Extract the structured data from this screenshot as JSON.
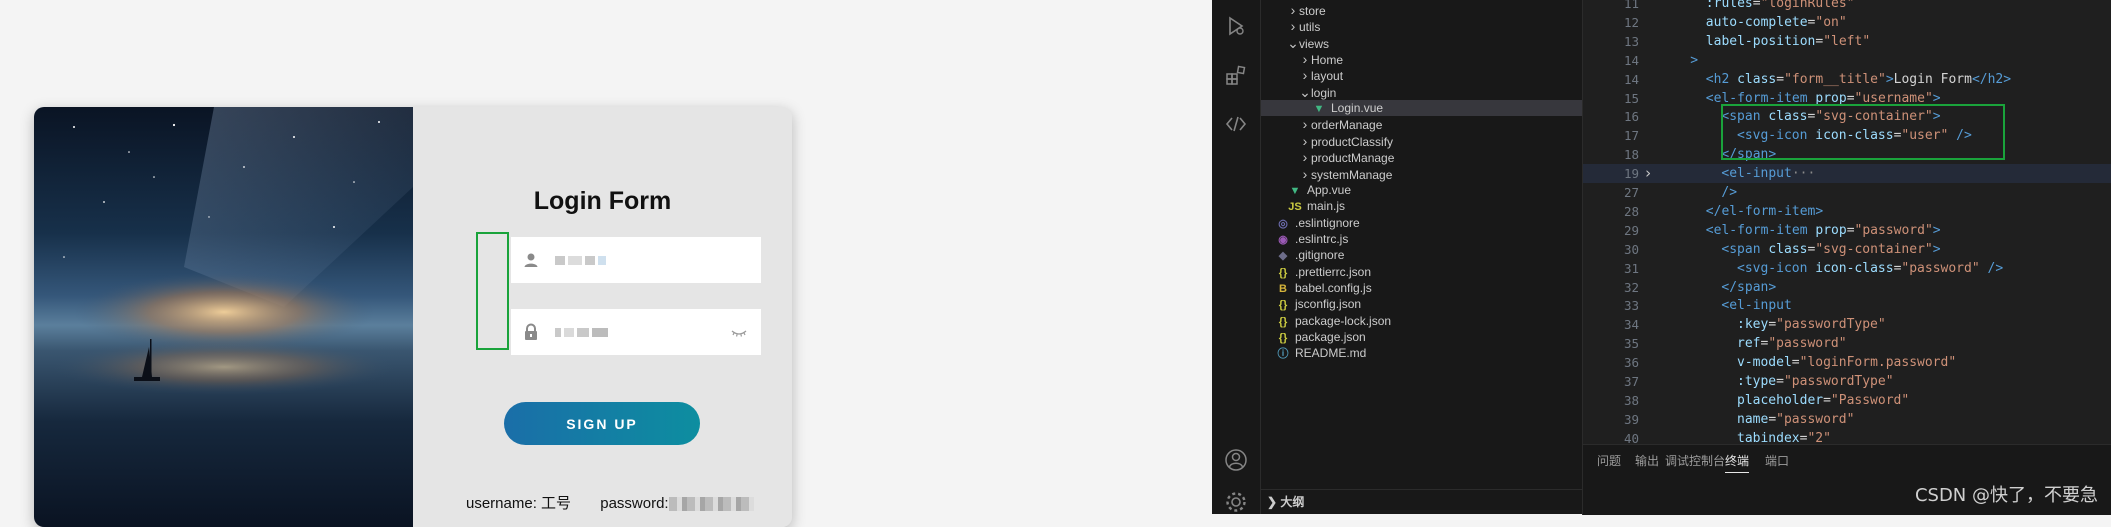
{
  "login": {
    "title": "Login Form",
    "username_placeholder": "",
    "signup_label": "SIGN UP",
    "creds_username": "username: 工号",
    "creds_password": "password:"
  },
  "explorer": {
    "items": [
      {
        "label": "store",
        "type": "folder",
        "open": false,
        "indent": 1
      },
      {
        "label": "utils",
        "type": "folder",
        "open": false,
        "indent": 1
      },
      {
        "label": "views",
        "type": "folder",
        "open": true,
        "indent": 1
      },
      {
        "label": "Home",
        "type": "folder",
        "open": false,
        "indent": 2
      },
      {
        "label": "layout",
        "type": "folder",
        "open": false,
        "indent": 2
      },
      {
        "label": "login",
        "type": "folder",
        "open": true,
        "indent": 2
      },
      {
        "label": "Login.vue",
        "type": "vue",
        "indent": 3,
        "active": true
      },
      {
        "label": "orderManage",
        "type": "folder",
        "open": false,
        "indent": 2
      },
      {
        "label": "productClassify",
        "type": "folder",
        "open": false,
        "indent": 2
      },
      {
        "label": "productManage",
        "type": "folder",
        "open": false,
        "indent": 2
      },
      {
        "label": "systemManage",
        "type": "folder",
        "open": false,
        "indent": 2
      },
      {
        "label": "App.vue",
        "type": "vue",
        "indent": 1
      },
      {
        "label": "main.js",
        "type": "js",
        "indent": 1
      },
      {
        "label": ".eslintignore",
        "type": "eslintignore",
        "indent": 0
      },
      {
        "label": ".eslintrc.js",
        "type": "eslintrc",
        "indent": 0
      },
      {
        "label": ".gitignore",
        "type": "git",
        "indent": 0
      },
      {
        "label": ".prettierrc.json",
        "type": "json",
        "indent": 0
      },
      {
        "label": "babel.config.js",
        "type": "babel",
        "indent": 0
      },
      {
        "label": "jsconfig.json",
        "type": "json",
        "indent": 0
      },
      {
        "label": "package-lock.json",
        "type": "json",
        "indent": 0
      },
      {
        "label": "package.json",
        "type": "json",
        "indent": 0
      },
      {
        "label": "README.md",
        "type": "info",
        "indent": 0
      }
    ],
    "outline_label": "大纲"
  },
  "code": {
    "lines": [
      {
        "n": "11",
        "indent": 6,
        "parts": [
          [
            "attr",
            ":rules"
          ],
          [
            "txt",
            "="
          ],
          [
            "str",
            "\"loginRules\""
          ]
        ]
      },
      {
        "n": "12",
        "indent": 6,
        "parts": [
          [
            "attr",
            "auto-complete"
          ],
          [
            "txt",
            "="
          ],
          [
            "str",
            "\"on\""
          ]
        ]
      },
      {
        "n": "13",
        "indent": 6,
        "parts": [
          [
            "attr",
            "label-position"
          ],
          [
            "txt",
            "="
          ],
          [
            "str",
            "\"left\""
          ]
        ]
      },
      {
        "n": "14",
        "indent": 4,
        "parts": [
          [
            "tag",
            ">"
          ]
        ]
      },
      {
        "n": "14",
        "indent": 6,
        "parts": [
          [
            "tag",
            "<h2 "
          ],
          [
            "attr",
            "class"
          ],
          [
            "txt",
            "="
          ],
          [
            "str",
            "\"form__title\""
          ],
          [
            "tag",
            ">"
          ],
          [
            "txt",
            "Login Form"
          ],
          [
            "tag",
            "</h2>"
          ]
        ]
      },
      {
        "n": "15",
        "indent": 6,
        "parts": [
          [
            "tag",
            "<el-form-item "
          ],
          [
            "attr",
            "prop"
          ],
          [
            "txt",
            "="
          ],
          [
            "str",
            "\"username\""
          ],
          [
            "tag",
            ">"
          ]
        ]
      },
      {
        "n": "16",
        "indent": 8,
        "parts": [
          [
            "tag",
            "<span "
          ],
          [
            "attr",
            "class"
          ],
          [
            "txt",
            "="
          ],
          [
            "str",
            "\"svg-container\""
          ],
          [
            "tag",
            ">"
          ]
        ]
      },
      {
        "n": "17",
        "indent": 10,
        "parts": [
          [
            "tag",
            "<svg-icon "
          ],
          [
            "attr",
            "icon-class"
          ],
          [
            "txt",
            "="
          ],
          [
            "str",
            "\"user\""
          ],
          [
            "tag",
            " />"
          ]
        ]
      },
      {
        "n": "18",
        "indent": 8,
        "parts": [
          [
            "tag",
            "</span>"
          ]
        ]
      },
      {
        "n": "19",
        "indent": 8,
        "fold": true,
        "hl": true,
        "parts": [
          [
            "tag",
            "<el-input"
          ],
          [
            "fold",
            "···"
          ]
        ]
      },
      {
        "n": "27",
        "indent": 8,
        "parts": [
          [
            "tag",
            "/>"
          ]
        ]
      },
      {
        "n": "28",
        "indent": 6,
        "parts": [
          [
            "tag",
            "</el-form-item>"
          ]
        ]
      },
      {
        "n": "29",
        "indent": 6,
        "parts": [
          [
            "tag",
            "<el-form-item "
          ],
          [
            "attr",
            "prop"
          ],
          [
            "txt",
            "="
          ],
          [
            "str",
            "\"password\""
          ],
          [
            "tag",
            ">"
          ]
        ]
      },
      {
        "n": "30",
        "indent": 8,
        "parts": [
          [
            "tag",
            "<span "
          ],
          [
            "attr",
            "class"
          ],
          [
            "txt",
            "="
          ],
          [
            "str",
            "\"svg-container\""
          ],
          [
            "tag",
            ">"
          ]
        ]
      },
      {
        "n": "31",
        "indent": 10,
        "parts": [
          [
            "tag",
            "<svg-icon "
          ],
          [
            "attr",
            "icon-class"
          ],
          [
            "txt",
            "="
          ],
          [
            "str",
            "\"password\""
          ],
          [
            "tag",
            " />"
          ]
        ]
      },
      {
        "n": "32",
        "indent": 8,
        "parts": [
          [
            "tag",
            "</span>"
          ]
        ]
      },
      {
        "n": "33",
        "indent": 8,
        "parts": [
          [
            "tag",
            "<el-input"
          ]
        ]
      },
      {
        "n": "34",
        "indent": 10,
        "parts": [
          [
            "attr",
            ":key"
          ],
          [
            "txt",
            "="
          ],
          [
            "str",
            "\"passwordType\""
          ]
        ]
      },
      {
        "n": "35",
        "indent": 10,
        "parts": [
          [
            "attr",
            "ref"
          ],
          [
            "txt",
            "="
          ],
          [
            "str",
            "\"password\""
          ]
        ]
      },
      {
        "n": "36",
        "indent": 10,
        "parts": [
          [
            "attr",
            "v-model"
          ],
          [
            "txt",
            "="
          ],
          [
            "str",
            "\"loginForm.password\""
          ]
        ]
      },
      {
        "n": "37",
        "indent": 10,
        "parts": [
          [
            "attr",
            ":type"
          ],
          [
            "txt",
            "="
          ],
          [
            "str",
            "\"passwordType\""
          ]
        ]
      },
      {
        "n": "38",
        "indent": 10,
        "parts": [
          [
            "attr",
            "placeholder"
          ],
          [
            "txt",
            "="
          ],
          [
            "str",
            "\"Password\""
          ]
        ]
      },
      {
        "n": "39",
        "indent": 10,
        "parts": [
          [
            "attr",
            "name"
          ],
          [
            "txt",
            "="
          ],
          [
            "str",
            "\"password\""
          ]
        ]
      },
      {
        "n": "40",
        "indent": 10,
        "parts": [
          [
            "attr",
            "tabindex"
          ],
          [
            "txt",
            "="
          ],
          [
            "str",
            "\"2\""
          ]
        ]
      }
    ]
  },
  "panel": {
    "tabs": [
      "问题",
      "输出",
      "调试控制台",
      "终端",
      "端口"
    ],
    "active_tab": "终端"
  },
  "watermark": "CSDN @快了，不要急",
  "colors": {
    "accent": "#1aa33b",
    "signup_start": "#1a6ea8",
    "signup_end": "#0d8ea0"
  }
}
